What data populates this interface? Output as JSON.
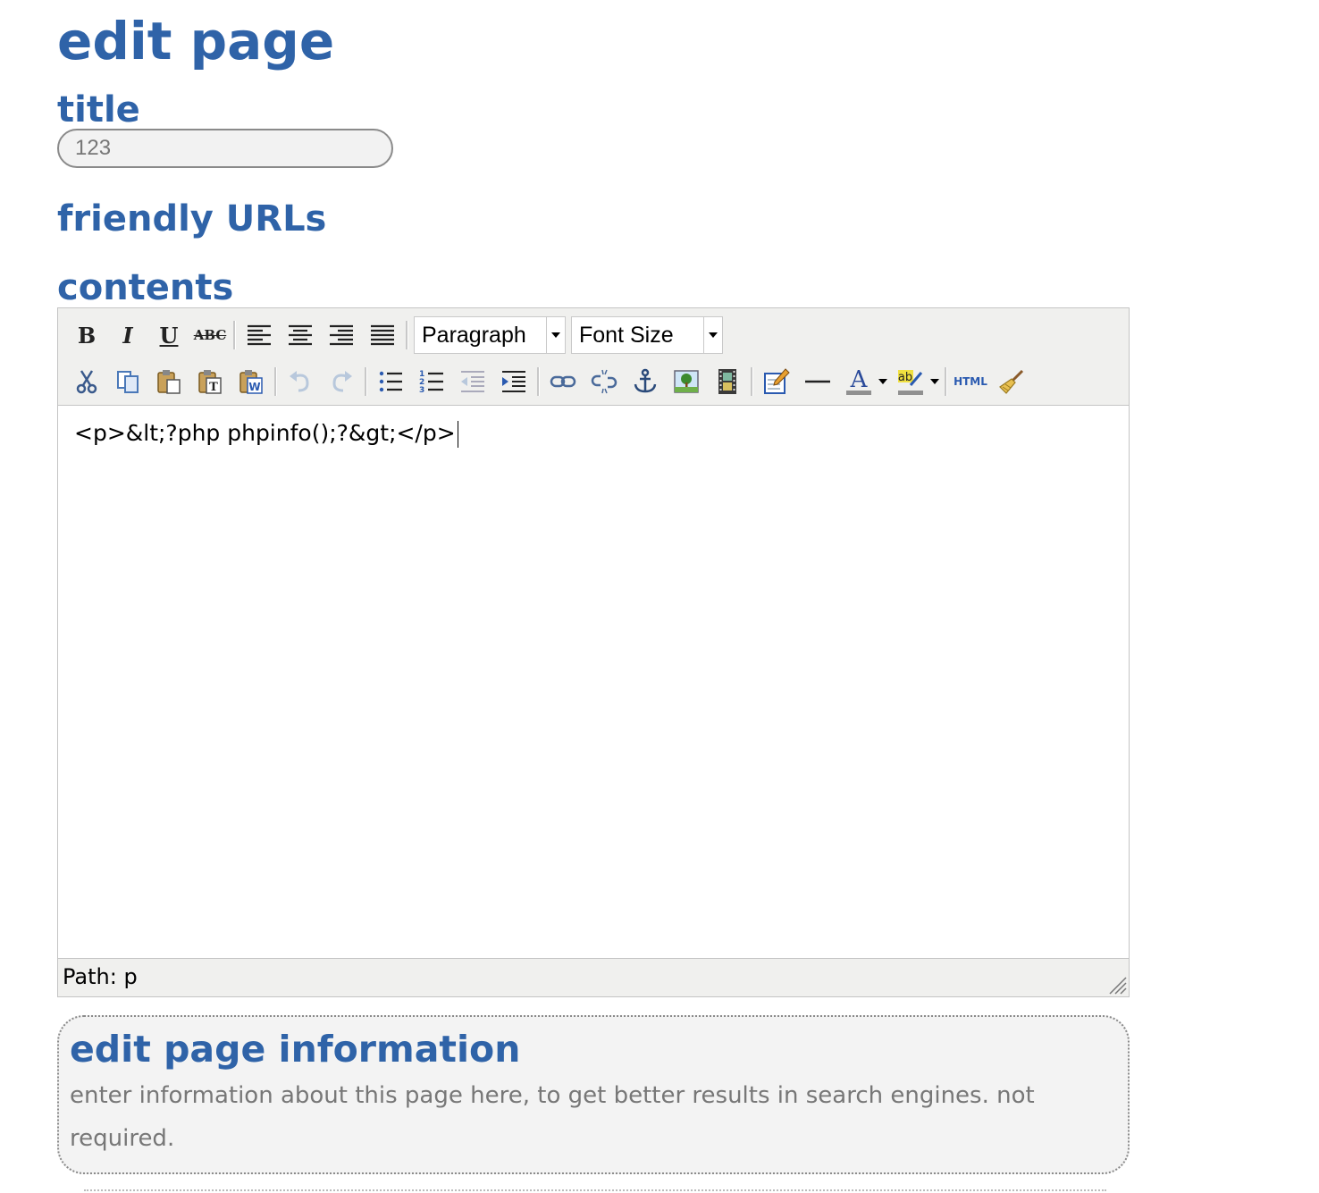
{
  "page": {
    "title": "edit page",
    "title_section_label": "title",
    "title_value": "123",
    "friendly_urls_label": "friendly URLs",
    "contents_label": "contents"
  },
  "editor": {
    "toolbar": {
      "row1": {
        "buttons": [
          "bold-icon",
          "italic-icon",
          "underline-icon",
          "strikethrough-icon",
          "align-left-icon",
          "align-center-icon",
          "align-right-icon",
          "align-justify-icon"
        ],
        "format_select": "Paragraph",
        "fontsize_select": "Font Size"
      },
      "row2": {
        "buttons": [
          "cut-icon",
          "copy-icon",
          "paste-icon",
          "paste-text-icon",
          "paste-word-icon",
          "undo-icon",
          "redo-icon",
          "bullet-list-icon",
          "numbered-list-icon",
          "outdent-icon",
          "indent-icon",
          "link-icon",
          "unlink-icon",
          "anchor-icon",
          "image-icon",
          "media-icon",
          "edit-icon",
          "horizontal-rule-icon",
          "text-color-icon",
          "highlight-color-icon",
          "html-source-icon",
          "cleanup-icon"
        ],
        "html_label": "HTML"
      }
    },
    "content": "<p>&lt;?php phpinfo();?&gt;</p>",
    "status_path": "Path: p"
  },
  "info": {
    "title": "edit page information",
    "description": "enter information about this page here, to get better results in search engines. not required."
  },
  "colors": {
    "heading": "#2f63a8",
    "toolbar_bg": "#f0f0ee",
    "info_bg": "#f3f3f3"
  }
}
